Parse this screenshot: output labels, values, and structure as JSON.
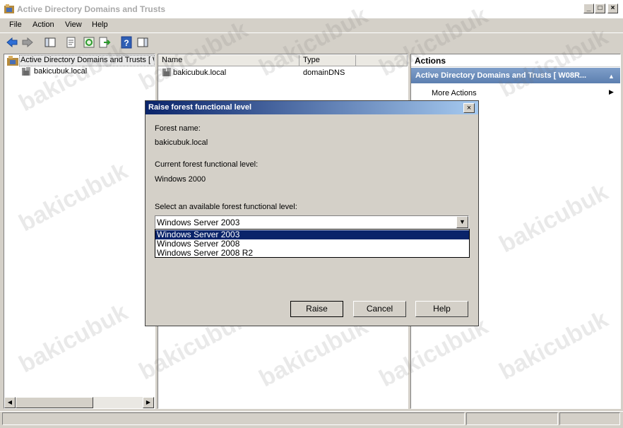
{
  "window": {
    "title": "Active Directory Domains and Trusts",
    "caption_buttons": {
      "minimize": "_",
      "maximize": "□",
      "close": "×"
    }
  },
  "menu": [
    "File",
    "Action",
    "View",
    "Help"
  ],
  "toolbar": {
    "icons": [
      "back-arrow-icon",
      "forward-arrow-icon",
      "show-hide-console-tree-icon",
      "properties-icon",
      "refresh-icon",
      "export-list-icon",
      "help-icon",
      "show-hide-action-pane-icon"
    ]
  },
  "tree": {
    "root": "Active Directory Domains and Trusts [ W",
    "child": "bakicubuk.local"
  },
  "list": {
    "columns": [
      "Name",
      "Type"
    ],
    "rows": [
      {
        "name": "bakicubuk.local",
        "type": "domainDNS"
      }
    ]
  },
  "actions": {
    "header": "Actions",
    "section": "Active Directory Domains and Trusts [ W08R...",
    "items": [
      "More Actions"
    ]
  },
  "dialog": {
    "title": "Raise forest functional level",
    "forest_name_label": "Forest name:",
    "forest_name": "bakicubuk.local",
    "current_level_label": "Current forest functional level:",
    "current_level": "Windows 2000",
    "select_label": "Select an available forest functional level:",
    "selected": "Windows Server 2003",
    "options": [
      "Windows Server 2003",
      "Windows Server 2008",
      "Windows Server 2008 R2"
    ],
    "buttons": {
      "raise": "Raise",
      "cancel": "Cancel",
      "help": "Help"
    },
    "close": "×"
  },
  "watermark": "bakicubuk",
  "colors": {
    "dialog_title": "#0a246a",
    "selection": "#0a246a",
    "actions_section": "#6a8cbd"
  }
}
